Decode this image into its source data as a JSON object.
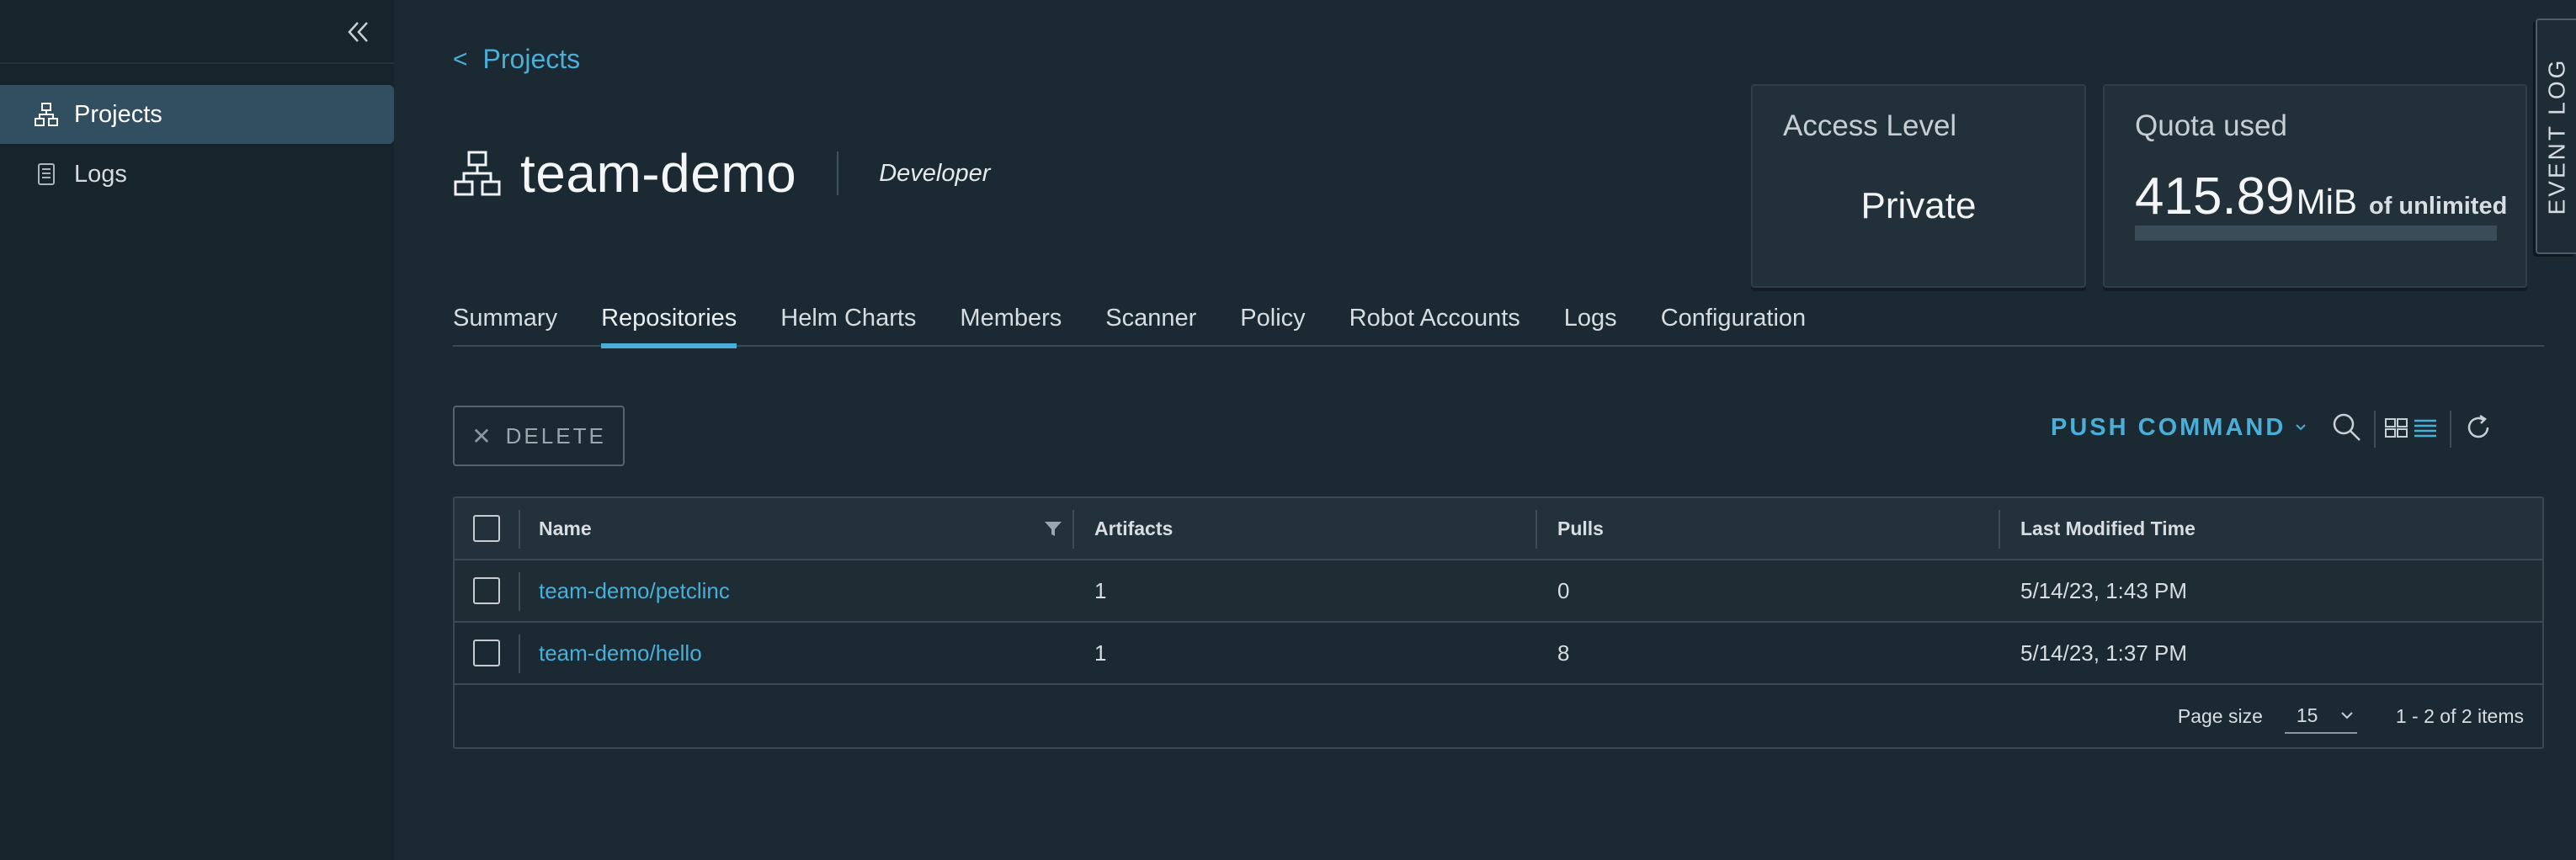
{
  "sidebar": {
    "items": [
      {
        "label": "Projects",
        "icon": "projects-icon",
        "active": true
      },
      {
        "label": "Logs",
        "icon": "logs-icon",
        "active": false
      }
    ]
  },
  "breadcrumb": {
    "label": "Projects"
  },
  "project": {
    "name": "team-demo",
    "role": "Developer"
  },
  "access_card": {
    "title": "Access Level",
    "value": "Private"
  },
  "quota_card": {
    "title": "Quota used",
    "amount": "415.89",
    "unit": "MiB",
    "of_label": "of unlimited",
    "fraction_used": 0
  },
  "event_log": {
    "label": "EVENT LOG"
  },
  "tabs": [
    {
      "label": "Summary"
    },
    {
      "label": "Repositories",
      "active": true
    },
    {
      "label": "Helm Charts"
    },
    {
      "label": "Members"
    },
    {
      "label": "Scanner"
    },
    {
      "label": "Policy"
    },
    {
      "label": "Robot Accounts"
    },
    {
      "label": "Logs"
    },
    {
      "label": "Configuration"
    }
  ],
  "toolbar": {
    "delete_label": "DELETE",
    "push_command_label": "PUSH COMMAND"
  },
  "table": {
    "columns": [
      "Name",
      "Artifacts",
      "Pulls",
      "Last Modified Time"
    ],
    "rows": [
      {
        "name": "team-demo/petclinc",
        "artifacts": "1",
        "pulls": "0",
        "modified": "5/14/23, 1:43 PM"
      },
      {
        "name": "team-demo/hello",
        "artifacts": "1",
        "pulls": "8",
        "modified": "5/14/23, 1:37 PM"
      }
    ],
    "footer": {
      "page_size_label": "Page size",
      "page_size_value": "15",
      "range_label": "1 - 2 of 2 items"
    }
  },
  "colors": {
    "accent": "#49afd9",
    "sidebar_active": "#324f61",
    "background": "#1b2a32"
  }
}
